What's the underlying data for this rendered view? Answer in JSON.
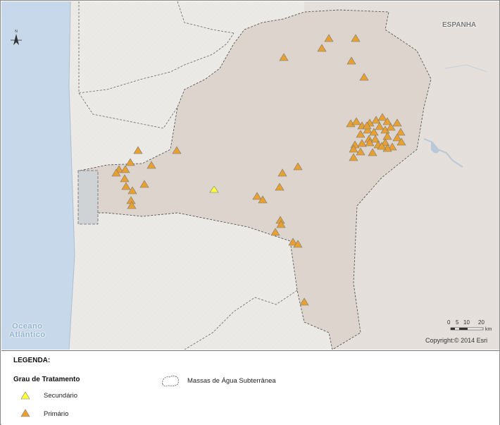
{
  "map": {
    "country_label": "ESPANHA",
    "ocean_label_line1": "Oceano",
    "ocean_label_line2": "Atlântico",
    "copyright": "Copyright:© 2014 Esri",
    "scale_bar": {
      "ticks": [
        "0",
        "5",
        "10",
        "20"
      ],
      "unit": "km"
    },
    "north_arrow_label": "N",
    "colors": {
      "ocean": "#c7d8ea",
      "land": "#e7e3de",
      "region": "#ddd5cd",
      "primary": "#e8a030",
      "secondary": "#ffff33"
    },
    "points_primary": [
      {
        "name": "primario-01"
      },
      {
        "name": "primario-02"
      },
      {
        "name": "primario-03"
      },
      {
        "name": "primario-04"
      },
      {
        "name": "primario-05"
      }
    ]
  },
  "legend": {
    "title": "LEGENDA:",
    "subtitle": "Grau de Tratamento",
    "items": [
      {
        "label": "Secundário",
        "symbol": "triangle-yellow"
      },
      {
        "label": "Primário",
        "symbol": "triangle-orange"
      }
    ],
    "water_label": "Massas de Água Subterrânea"
  }
}
